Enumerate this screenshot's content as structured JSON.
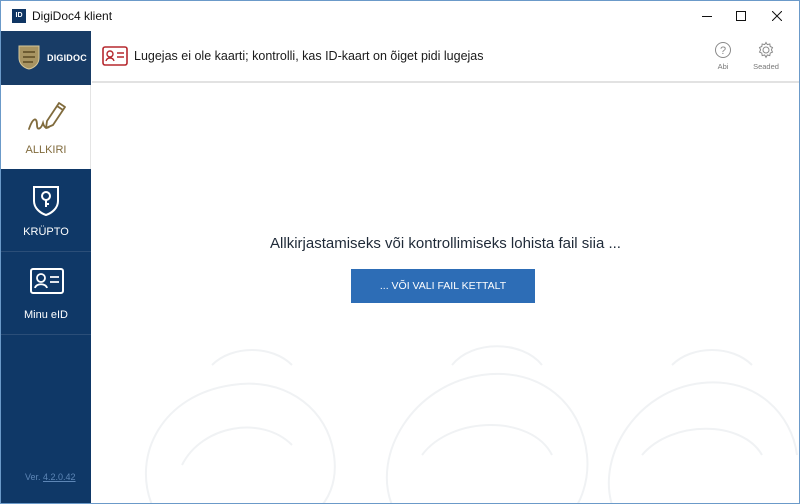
{
  "window": {
    "title": "DigiDoc4 klient",
    "app_icon_text": "ID"
  },
  "brand": {
    "name": "DIGIDOC"
  },
  "sidebar": {
    "items": [
      {
        "label": "ALLKIRI",
        "icon": "signature-pen-icon",
        "active": true
      },
      {
        "label": "KRÜPTO",
        "icon": "shield-key-icon",
        "active": false
      },
      {
        "label": "Minu eID",
        "icon": "id-card-icon",
        "active": false
      }
    ],
    "version_prefix": "Ver. ",
    "version_number": "4.2.0.42"
  },
  "header": {
    "message": "Lugejas ei ole kaarti; kontrolli, kas ID-kaart on õiget pidi lugejas",
    "help_label": "Abi",
    "settings_label": "Seaded"
  },
  "main": {
    "drop_text": "Allkirjastamiseks või kontrollimiseks lohista fail siia ...",
    "choose_button": "... VÕI VALI FAIL KETTALT"
  },
  "colors": {
    "sidebar_bg": "#0f3867",
    "accent_gold": "#806b3d",
    "primary_button": "#2d6db6",
    "warning_red": "#b5282e"
  }
}
